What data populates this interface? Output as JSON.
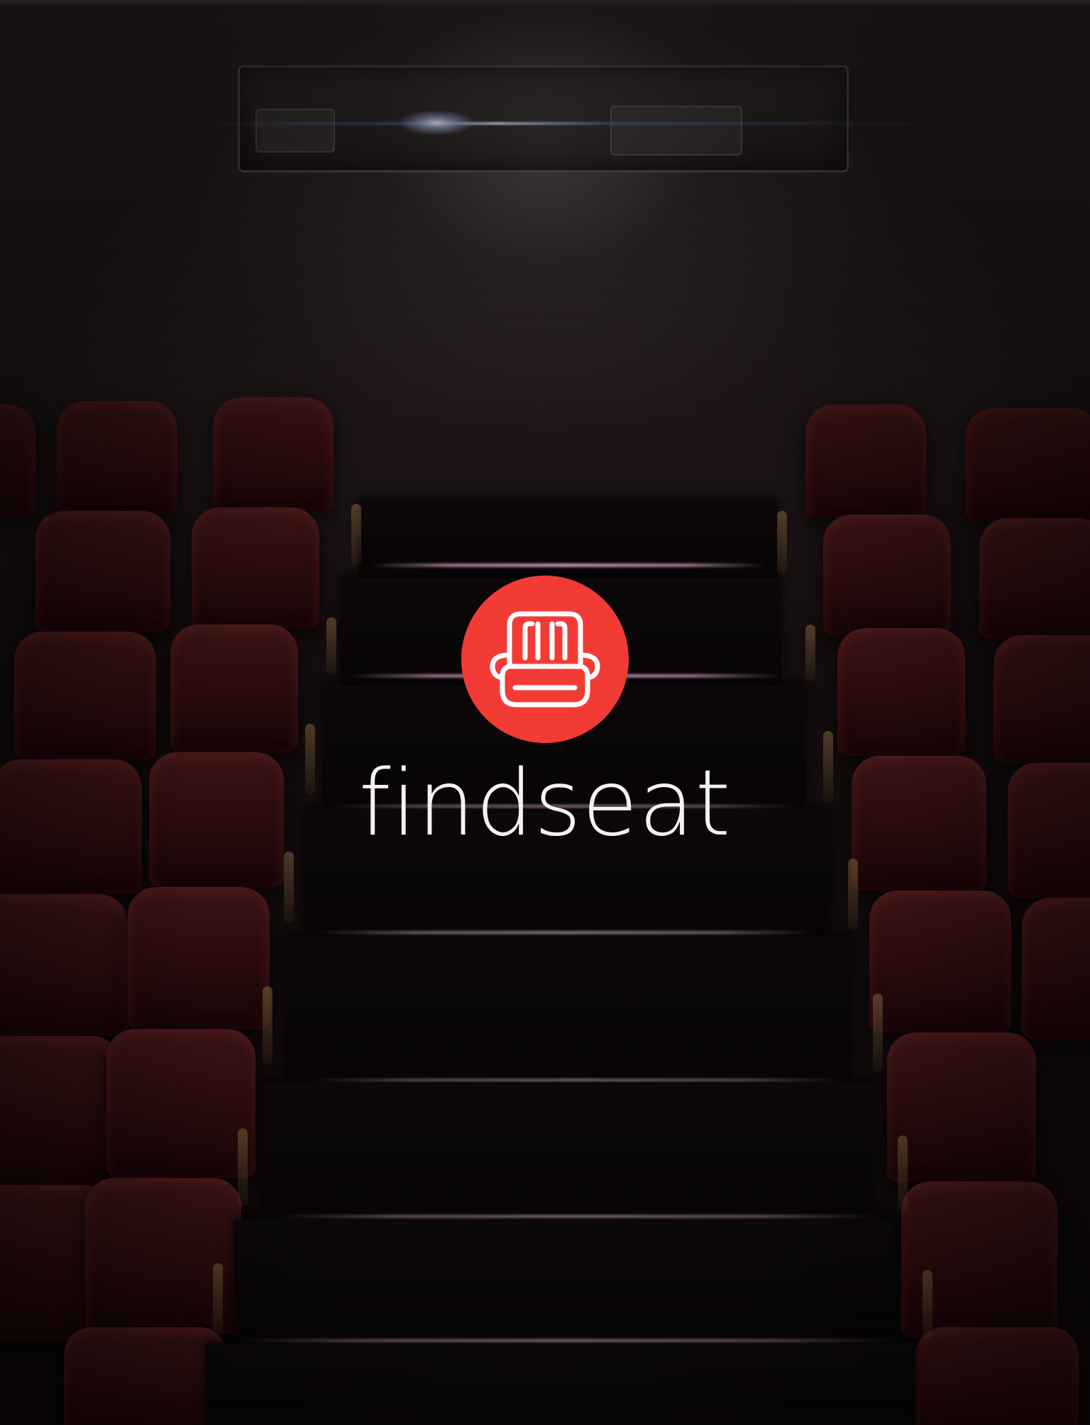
{
  "app": {
    "name": "findseat"
  },
  "logo": {
    "icon": "armchair-seat-icon",
    "badge_color": "#f33b36",
    "icon_color": "#ffffff"
  },
  "background": {
    "scene": "cinema-aisle",
    "seat_color": "#2a0b0c"
  }
}
